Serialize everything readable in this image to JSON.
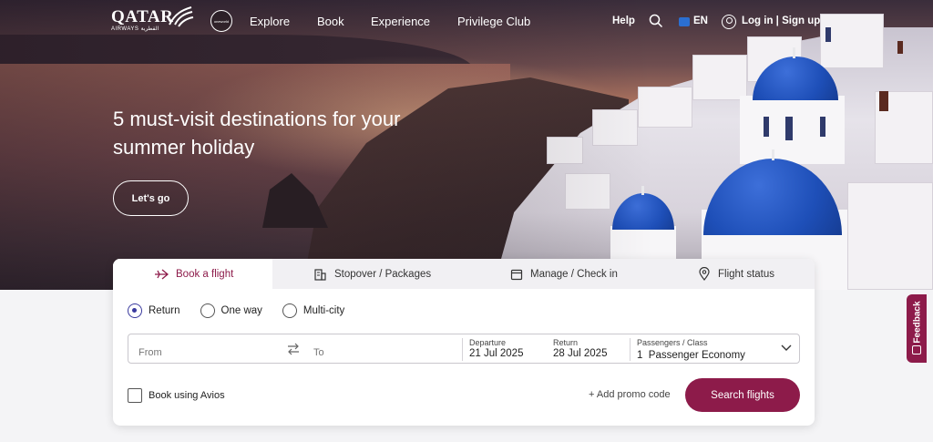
{
  "brand": {
    "logo_text": "QATAR",
    "logo_sub": "AIRWAYS القطرية",
    "alliance": "oneworld"
  },
  "nav": {
    "items": [
      {
        "label": "Explore"
      },
      {
        "label": "Book"
      },
      {
        "label": "Experience"
      },
      {
        "label": "Privilege Club"
      }
    ],
    "help": "Help",
    "language": "EN",
    "login": "Log in | Sign up"
  },
  "hero": {
    "headline": "5 must-visit destinations for your summer holiday",
    "cta": "Let's go"
  },
  "booking": {
    "tabs": [
      {
        "label": "Book a flight",
        "icon": "plane-icon",
        "active": true
      },
      {
        "label": "Stopover / Packages",
        "icon": "building-icon",
        "active": false
      },
      {
        "label": "Manage / Check in",
        "icon": "calendar-icon",
        "active": false
      },
      {
        "label": "Flight status",
        "icon": "location-pin-icon",
        "active": false
      }
    ],
    "trip_types": [
      {
        "label": "Return",
        "selected": true
      },
      {
        "label": "One way",
        "selected": false
      },
      {
        "label": "Multi-city",
        "selected": false
      }
    ],
    "from_placeholder": "From",
    "to_placeholder": "To",
    "departure": {
      "label": "Departure",
      "value": "21 Jul 2025"
    },
    "return": {
      "label": "Return",
      "value": "28 Jul 2025"
    },
    "passengers": {
      "label": "Passengers / Class",
      "value": "1  Passenger Economy"
    },
    "avios_label": "Book using Avios",
    "promo_label": "+ Add promo code",
    "search_label": "Search flights"
  },
  "feedback": {
    "label": "Feedback"
  },
  "colors": {
    "brand": "#8d1b4a",
    "radio": "#3a3a9e"
  }
}
